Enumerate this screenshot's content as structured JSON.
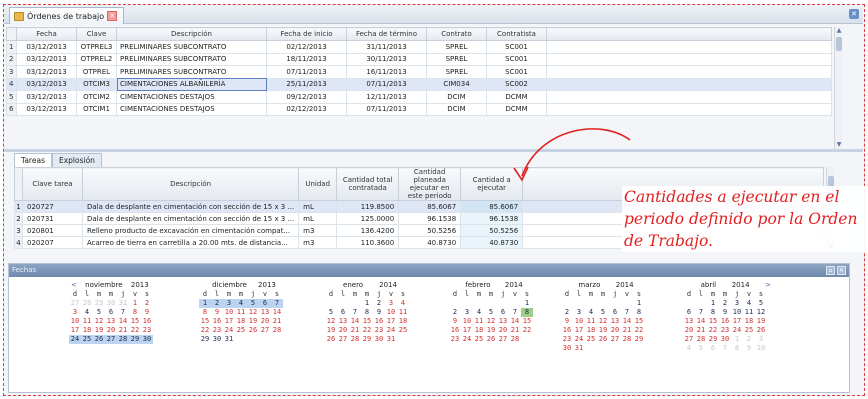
{
  "window": {
    "tab_label": "Órdenes de trabajo",
    "close_glyph": "✕"
  },
  "orders_grid": {
    "columns": [
      "Fecha",
      "Clave",
      "Descripción",
      "Fecha de inicio",
      "Fecha de término",
      "Contrato",
      "Contratista"
    ],
    "rows": [
      {
        "n": "1",
        "fecha": "03/12/2013",
        "clave": "OTPREL3",
        "descripcion": "PRELIMINARES SUBCONTRATO",
        "inicio": "02/12/2013",
        "termino": "31/11/2013",
        "contrato": "SPREL",
        "contratista": "SC001"
      },
      {
        "n": "2",
        "fecha": "03/12/2013",
        "clave": "OTPREL2",
        "descripcion": "PRELIMINARES SUBCONTRATO",
        "inicio": "18/11/2013",
        "termino": "30/11/2013",
        "contrato": "SPREL",
        "contratista": "SC001"
      },
      {
        "n": "3",
        "fecha": "03/12/2013",
        "clave": "OTPREL",
        "descripcion": "PRELIMINARES SUBCONTRATO",
        "inicio": "07/11/2013",
        "termino": "16/11/2013",
        "contrato": "SPREL",
        "contratista": "SC001"
      },
      {
        "n": "4",
        "fecha": "03/12/2013",
        "clave": "OTCIM3",
        "descripcion": "CIMENTACIONES ALBAÑILERÍA",
        "inicio": "25/11/2013",
        "termino": "07/11/2013",
        "contrato": "CIM034",
        "contratista": "SC002"
      },
      {
        "n": "5",
        "fecha": "03/12/2013",
        "clave": "OTCIM2",
        "descripcion": "CIMENTACIONES DESTAJOS",
        "inicio": "09/12/2013",
        "termino": "12/11/2013",
        "contrato": "DCIM",
        "contratista": "DCMM"
      },
      {
        "n": "6",
        "fecha": "03/12/2013",
        "clave": "OTCIM1",
        "descripcion": "CIMENTACIONES DESTAJOS",
        "inicio": "02/12/2013",
        "termino": "07/11/2013",
        "contrato": "DCIM",
        "contratista": "DCMM"
      }
    ]
  },
  "subtabs": [
    "Tareas",
    "Explosión"
  ],
  "tasks_grid": {
    "columns": [
      "Clave tarea",
      "Descripción",
      "Unidad",
      "Cantidad total contratada",
      "Cantidad planeada ejecutar en este periodo",
      "Cantidad a ejecutar"
    ],
    "rows": [
      {
        "n": "1",
        "clave": "020727",
        "descripcion": "Dala de desplante en cimentación con sección de 15 x 3 ...",
        "unidad": "mL",
        "total": "119.8500",
        "planeada": "85.6067",
        "ejecutar": "85.6067"
      },
      {
        "n": "2",
        "clave": "020731",
        "descripcion": "Dala de desplante en cimentación con sección de 15 x 3 ...",
        "unidad": "mL",
        "total": "125.0000",
        "planeada": "96.1538",
        "ejecutar": "96.1538"
      },
      {
        "n": "3",
        "clave": "020801",
        "descripcion": "Relleno producto de excavación en cimentación compat...",
        "unidad": "m3",
        "total": "136.4200",
        "planeada": "50.5256",
        "ejecutar": "50.5256"
      },
      {
        "n": "4",
        "clave": "020207",
        "descripcion": "Acarreo de tierra en carretilla a 20.00 mts. de distancia...",
        "unidad": "m3",
        "total": "110.3600",
        "planeada": "40.8730",
        "ejecutar": "40.8730"
      }
    ]
  },
  "fechas": {
    "title": "Fechas",
    "weekdays": [
      "d",
      "l",
      "m",
      "m",
      "j",
      "v",
      "s"
    ],
    "months": [
      {
        "name": "noviembre",
        "year": "2013",
        "prev": "<",
        "next": "",
        "days": [
          [
            "27",
            "o"
          ],
          [
            "28",
            "o"
          ],
          [
            "29",
            "o"
          ],
          [
            "30",
            "o"
          ],
          [
            "31",
            "o"
          ],
          [
            "1",
            "w"
          ],
          [
            "2",
            "w"
          ],
          [
            "3",
            "w"
          ],
          [
            "4",
            ""
          ],
          [
            "5",
            ""
          ],
          [
            "6",
            ""
          ],
          [
            "7",
            ""
          ],
          [
            "8",
            "w"
          ],
          [
            "9",
            "w"
          ],
          [
            "10",
            "w"
          ],
          [
            "11",
            "w"
          ],
          [
            "12",
            "w"
          ],
          [
            "13",
            "w"
          ],
          [
            "14",
            "w"
          ],
          [
            "15",
            "w"
          ],
          [
            "16",
            "w"
          ],
          [
            "17",
            "w"
          ],
          [
            "18",
            "w"
          ],
          [
            "19",
            "w"
          ],
          [
            "20",
            "w"
          ],
          [
            "21",
            "w"
          ],
          [
            "22",
            "w"
          ],
          [
            "23",
            "w"
          ],
          [
            "24",
            "s"
          ],
          [
            "25",
            "s"
          ],
          [
            "26",
            "s"
          ],
          [
            "27",
            "s"
          ],
          [
            "28",
            "s"
          ],
          [
            "29",
            "s"
          ],
          [
            "30",
            "s"
          ]
        ]
      },
      {
        "name": "diciembre",
        "year": "2013",
        "prev": "",
        "next": "",
        "days": [
          [
            "1",
            "s"
          ],
          [
            "2",
            "s"
          ],
          [
            "3",
            "s"
          ],
          [
            "4",
            "s"
          ],
          [
            "5",
            "s"
          ],
          [
            "6",
            "s"
          ],
          [
            "7",
            "s"
          ],
          [
            "8",
            "w"
          ],
          [
            "9",
            "w"
          ],
          [
            "10",
            "w"
          ],
          [
            "11",
            "w"
          ],
          [
            "12",
            "w"
          ],
          [
            "13",
            "w"
          ],
          [
            "14",
            "w"
          ],
          [
            "15",
            "w"
          ],
          [
            "16",
            "w"
          ],
          [
            "17",
            "w"
          ],
          [
            "18",
            "w"
          ],
          [
            "19",
            "w"
          ],
          [
            "20",
            "w"
          ],
          [
            "21",
            "w"
          ],
          [
            "22",
            "w"
          ],
          [
            "23",
            "w"
          ],
          [
            "24",
            "w"
          ],
          [
            "25",
            "w"
          ],
          [
            "26",
            "w"
          ],
          [
            "27",
            "w"
          ],
          [
            "28",
            "w"
          ],
          [
            "29",
            ""
          ],
          [
            "30",
            ""
          ],
          [
            "31",
            ""
          ]
        ]
      },
      {
        "name": "enero",
        "year": "2014",
        "prev": "",
        "next": "",
        "days": [
          [
            "",
            "o"
          ],
          [
            "",
            "o"
          ],
          [
            "",
            "o"
          ],
          [
            "1",
            ""
          ],
          [
            "2",
            ""
          ],
          [
            "3",
            "w"
          ],
          [
            "4",
            "w"
          ],
          [
            "5",
            ""
          ],
          [
            "6",
            ""
          ],
          [
            "7",
            ""
          ],
          [
            "8",
            ""
          ],
          [
            "9",
            ""
          ],
          [
            "10",
            "w"
          ],
          [
            "11",
            "w"
          ],
          [
            "12",
            "w"
          ],
          [
            "13",
            "w"
          ],
          [
            "14",
            "w"
          ],
          [
            "15",
            "w"
          ],
          [
            "16",
            "w"
          ],
          [
            "17",
            "w"
          ],
          [
            "18",
            "w"
          ],
          [
            "19",
            "w"
          ],
          [
            "20",
            "w"
          ],
          [
            "21",
            "w"
          ],
          [
            "22",
            "w"
          ],
          [
            "23",
            "w"
          ],
          [
            "24",
            "w"
          ],
          [
            "25",
            "w"
          ],
          [
            "26",
            "w"
          ],
          [
            "27",
            "w"
          ],
          [
            "28",
            "w"
          ],
          [
            "29",
            "w"
          ],
          [
            "30",
            "w"
          ],
          [
            "31",
            "w"
          ]
        ]
      },
      {
        "name": "febrero",
        "year": "2014",
        "prev": "",
        "next": "",
        "days": [
          [
            "",
            "o"
          ],
          [
            "",
            "o"
          ],
          [
            "",
            "o"
          ],
          [
            "",
            "o"
          ],
          [
            "",
            "o"
          ],
          [
            "",
            "o"
          ],
          [
            "1",
            ""
          ],
          [
            "2",
            ""
          ],
          [
            "3",
            ""
          ],
          [
            "4",
            ""
          ],
          [
            "5",
            ""
          ],
          [
            "6",
            ""
          ],
          [
            "7",
            ""
          ],
          [
            "8",
            "g"
          ],
          [
            "9",
            "w"
          ],
          [
            "10",
            "w"
          ],
          [
            "11",
            "w"
          ],
          [
            "12",
            "w"
          ],
          [
            "13",
            "w"
          ],
          [
            "14",
            "w"
          ],
          [
            "15",
            "w"
          ],
          [
            "16",
            "w"
          ],
          [
            "17",
            "w"
          ],
          [
            "18",
            "w"
          ],
          [
            "19",
            "w"
          ],
          [
            "20",
            "w"
          ],
          [
            "21",
            "w"
          ],
          [
            "22",
            "w"
          ],
          [
            "23",
            "w"
          ],
          [
            "24",
            "w"
          ],
          [
            "25",
            "w"
          ],
          [
            "26",
            "w"
          ],
          [
            "27",
            "w"
          ],
          [
            "28",
            "w"
          ]
        ]
      },
      {
        "name": "marzo",
        "year": "2014",
        "prev": "",
        "next": "",
        "days": [
          [
            "",
            "o"
          ],
          [
            "",
            "o"
          ],
          [
            "",
            "o"
          ],
          [
            "",
            "o"
          ],
          [
            "",
            "o"
          ],
          [
            "",
            "o"
          ],
          [
            "1",
            ""
          ],
          [
            "2",
            ""
          ],
          [
            "3",
            ""
          ],
          [
            "4",
            ""
          ],
          [
            "5",
            ""
          ],
          [
            "6",
            ""
          ],
          [
            "7",
            ""
          ],
          [
            "8",
            ""
          ],
          [
            "9",
            "w"
          ],
          [
            "10",
            "w"
          ],
          [
            "11",
            "w"
          ],
          [
            "12",
            "w"
          ],
          [
            "13",
            "w"
          ],
          [
            "14",
            "w"
          ],
          [
            "15",
            "w"
          ],
          [
            "16",
            "w"
          ],
          [
            "17",
            "w"
          ],
          [
            "18",
            "w"
          ],
          [
            "19",
            "w"
          ],
          [
            "20",
            "w"
          ],
          [
            "21",
            "w"
          ],
          [
            "22",
            "w"
          ],
          [
            "23",
            "w"
          ],
          [
            "24",
            "w"
          ],
          [
            "25",
            "w"
          ],
          [
            "26",
            "w"
          ],
          [
            "27",
            "w"
          ],
          [
            "28",
            "w"
          ],
          [
            "29",
            "w"
          ],
          [
            "30",
            "w"
          ],
          [
            "31",
            "w"
          ]
        ]
      },
      {
        "name": "abril",
        "year": "2014",
        "prev": "",
        "next": ">",
        "days": [
          [
            "",
            "o"
          ],
          [
            "",
            "o"
          ],
          [
            "1",
            ""
          ],
          [
            "2",
            ""
          ],
          [
            "3",
            ""
          ],
          [
            "4",
            ""
          ],
          [
            "5",
            ""
          ],
          [
            "6",
            ""
          ],
          [
            "7",
            ""
          ],
          [
            "8",
            ""
          ],
          [
            "9",
            ""
          ],
          [
            "10",
            ""
          ],
          [
            "11",
            ""
          ],
          [
            "12",
            ""
          ],
          [
            "13",
            "w"
          ],
          [
            "14",
            "w"
          ],
          [
            "15",
            "w"
          ],
          [
            "16",
            "w"
          ],
          [
            "17",
            "w"
          ],
          [
            "18",
            "w"
          ],
          [
            "19",
            "w"
          ],
          [
            "20",
            "w"
          ],
          [
            "21",
            "w"
          ],
          [
            "22",
            "w"
          ],
          [
            "23",
            "w"
          ],
          [
            "24",
            "w"
          ],
          [
            "25",
            "w"
          ],
          [
            "26",
            "w"
          ],
          [
            "27",
            "w"
          ],
          [
            "28",
            "w"
          ],
          [
            "29",
            "w"
          ],
          [
            "30",
            "w"
          ],
          [
            "1",
            "o"
          ],
          [
            "2",
            "o"
          ],
          [
            "3",
            "o"
          ],
          [
            "4",
            "o"
          ],
          [
            "5",
            "o"
          ],
          [
            "6",
            "o"
          ],
          [
            "7",
            "o"
          ],
          [
            "8",
            "o"
          ],
          [
            "9",
            "o"
          ],
          [
            "10",
            "o"
          ]
        ]
      }
    ]
  },
  "annotation": {
    "text": "Cantidades a ejecutar en el periodo definido por la Orden de Trabajo.",
    "color": "#e22020"
  }
}
